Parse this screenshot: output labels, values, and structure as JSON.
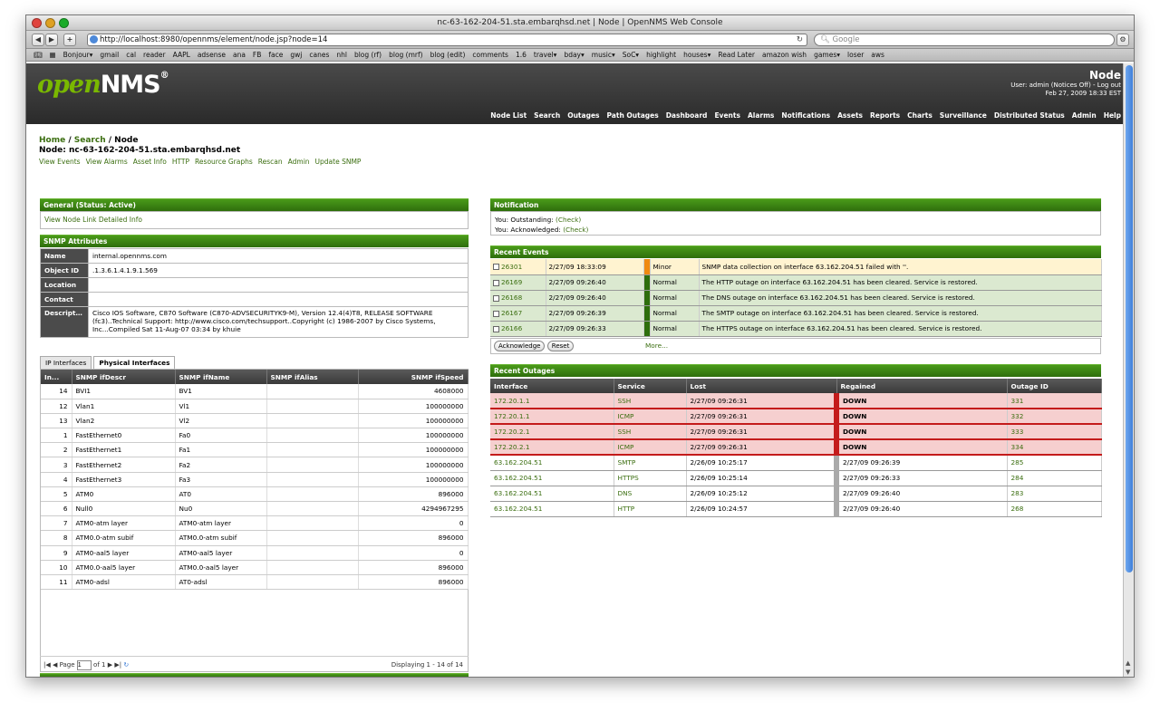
{
  "browser": {
    "window_title": "nc-63-162-204-51.sta.embarqhsd.net | Node | OpenNMS Web Console",
    "url": "http://localhost:8980/opennms/element/node.jsp?node=14",
    "search_placeholder": "Google",
    "bookmarks": [
      "Bonjour▾",
      "gmail",
      "cal",
      "reader",
      "AAPL",
      "adsense",
      "ana",
      "FB",
      "face",
      "gwj",
      "canes",
      "nhl",
      "blog (rf)",
      "blog (mrf)",
      "blog (edit)",
      "comments",
      "1.6",
      "travel▾",
      "bday▾",
      "music▾",
      "SoC▾",
      "highlight",
      "houses▾",
      "Read Later",
      "amazon wish",
      "games▾",
      "loser",
      "aws"
    ]
  },
  "header": {
    "logo_text_open": "open",
    "logo_text_nms": "NMS",
    "logo_reg": "®",
    "page_title": "Node",
    "user_line": "User: admin (Notices Off) - Log out",
    "date_line": "Feb 27, 2009   18:33 EST",
    "nav": [
      "Node List",
      "Search",
      "Outages",
      "Path Outages",
      "Dashboard",
      "Events",
      "Alarms",
      "Notifications",
      "Assets",
      "Reports",
      "Charts",
      "Surveillance",
      "Distributed Status",
      "Admin",
      "Help"
    ]
  },
  "breadcrumb": {
    "home": "Home",
    "sep1": " / ",
    "search": "Search",
    "sep2": " / ",
    "current": "Node"
  },
  "node": {
    "label": "Node: nc-63-162-204-51.sta.embarqhsd.net",
    "links": [
      "View Events",
      "View Alarms",
      "Asset Info",
      "HTTP",
      "Resource Graphs",
      "Rescan",
      "Admin",
      "Update SNMP"
    ]
  },
  "general": {
    "title": "General (Status: Active)",
    "link": "View Node Link Detailed Info"
  },
  "snmp": {
    "title": "SNMP Attributes",
    "rows": [
      {
        "k": "Name",
        "v": "internal.opennms.com"
      },
      {
        "k": "Object ID",
        "v": ".1.3.6.1.4.1.9.1.569"
      },
      {
        "k": "Location",
        "v": ""
      },
      {
        "k": "Contact",
        "v": ""
      },
      {
        "k": "Description",
        "v": "Cisco IOS Software, C870 Software (C870-ADVSECURITYK9-M), Version 12.4(4)T8, RELEASE SOFTWARE (fc3)..Technical Support: http://www.cisco.com/techsupport..Copyright (c) 1986-2007 by Cisco Systems, Inc...Compiled Sat 11-Aug-07 03:34 by khuie"
      }
    ]
  },
  "iftabs": {
    "tab1": "IP Interfaces",
    "tab2": "Physical Interfaces"
  },
  "interfaces": {
    "headers": [
      "In...",
      "SNMP ifDescr",
      "SNMP ifName",
      "SNMP ifAlias",
      "SNMP ifSpeed"
    ],
    "rows": [
      [
        "14",
        "BVI1",
        "BV1",
        "",
        "4608000"
      ],
      [
        "12",
        "Vlan1",
        "Vl1",
        "",
        "100000000"
      ],
      [
        "13",
        "Vlan2",
        "Vl2",
        "",
        "100000000"
      ],
      [
        "1",
        "FastEthernet0",
        "Fa0",
        "",
        "100000000"
      ],
      [
        "2",
        "FastEthernet1",
        "Fa1",
        "",
        "100000000"
      ],
      [
        "3",
        "FastEthernet2",
        "Fa2",
        "",
        "100000000"
      ],
      [
        "4",
        "FastEthernet3",
        "Fa3",
        "",
        "100000000"
      ],
      [
        "5",
        "ATM0",
        "AT0",
        "",
        "896000"
      ],
      [
        "6",
        "Null0",
        "Nu0",
        "",
        "4294967295"
      ],
      [
        "7",
        "ATM0-atm layer",
        "ATM0-atm layer",
        "",
        "0"
      ],
      [
        "8",
        "ATM0.0-atm subif",
        "ATM0.0-atm subif",
        "",
        "896000"
      ],
      [
        "9",
        "ATM0-aal5 layer",
        "ATM0-aal5 layer",
        "",
        "0"
      ],
      [
        "10",
        "ATM0.0-aal5 layer",
        "ATM0.0-aal5 layer",
        "",
        "896000"
      ],
      [
        "11",
        "ATM0-adsl",
        "AT0-adsl",
        "",
        "896000"
      ]
    ],
    "pager_page_label": "Page",
    "pager_page": "1",
    "pager_of": "of 1",
    "pager_display": "Displaying 1 - 14 of 14"
  },
  "notification": {
    "title": "Notification",
    "outstanding_label": "You: Outstanding: ",
    "outstanding_link": "(Check)",
    "ack_label": "You: Acknowledged: ",
    "ack_link": "(Check)"
  },
  "events": {
    "title": "Recent Events",
    "rows": [
      {
        "id": "26301",
        "time": "2/27/09 18:33:09",
        "sev": "Minor",
        "msg": "SNMP data collection on interface 63.162.204.51 failed with ''.",
        "cls": "minor"
      },
      {
        "id": "26169",
        "time": "2/27/09 09:26:40",
        "sev": "Normal",
        "msg": "The HTTP outage on interface 63.162.204.51 has been cleared. Service is restored.",
        "cls": "normal"
      },
      {
        "id": "26168",
        "time": "2/27/09 09:26:40",
        "sev": "Normal",
        "msg": "The DNS outage on interface 63.162.204.51 has been cleared. Service is restored.",
        "cls": "normal"
      },
      {
        "id": "26167",
        "time": "2/27/09 09:26:39",
        "sev": "Normal",
        "msg": "The SMTP outage on interface 63.162.204.51 has been cleared. Service is restored.",
        "cls": "normal"
      },
      {
        "id": "26166",
        "time": "2/27/09 09:26:33",
        "sev": "Normal",
        "msg": "The HTTPS outage on interface 63.162.204.51 has been cleared. Service is restored.",
        "cls": "normal"
      }
    ],
    "ack_button": "Acknowledge",
    "reset_button": "Reset",
    "more_link": "More..."
  },
  "outages": {
    "title": "Recent Outages",
    "headers": [
      "Interface",
      "Service",
      "Lost",
      "Regained",
      "Outage ID"
    ],
    "rows": [
      {
        "iface": "172.20.1.1",
        "svc": "SSH",
        "lost": "2/27/09 09:26:31",
        "reg": "DOWN",
        "id": "331",
        "cls": "down"
      },
      {
        "iface": "172.20.1.1",
        "svc": "ICMP",
        "lost": "2/27/09 09:26:31",
        "reg": "DOWN",
        "id": "332",
        "cls": "down"
      },
      {
        "iface": "172.20.2.1",
        "svc": "SSH",
        "lost": "2/27/09 09:26:31",
        "reg": "DOWN",
        "id": "333",
        "cls": "down"
      },
      {
        "iface": "172.20.2.1",
        "svc": "ICMP",
        "lost": "2/27/09 09:26:31",
        "reg": "DOWN",
        "id": "334",
        "cls": "down"
      },
      {
        "iface": "63.162.204.51",
        "svc": "SMTP",
        "lost": "2/26/09 10:25:17",
        "reg": "2/27/09 09:26:39",
        "id": "285",
        "cls": "up"
      },
      {
        "iface": "63.162.204.51",
        "svc": "HTTPS",
        "lost": "2/26/09 10:25:14",
        "reg": "2/27/09 09:26:33",
        "id": "284",
        "cls": "up"
      },
      {
        "iface": "63.162.204.51",
        "svc": "DNS",
        "lost": "2/26/09 10:25:12",
        "reg": "2/27/09 09:26:40",
        "id": "283",
        "cls": "up"
      },
      {
        "iface": "63.162.204.51",
        "svc": "HTTP",
        "lost": "2/26/09 10:24:57",
        "reg": "2/27/09 09:26:40",
        "id": "268",
        "cls": "up"
      }
    ]
  },
  "colors": {
    "accent_green": "#3b6e10",
    "header_dark": "#2a2a2a",
    "down_red": "#c41b1b",
    "minor_orange": "#f08a10"
  }
}
